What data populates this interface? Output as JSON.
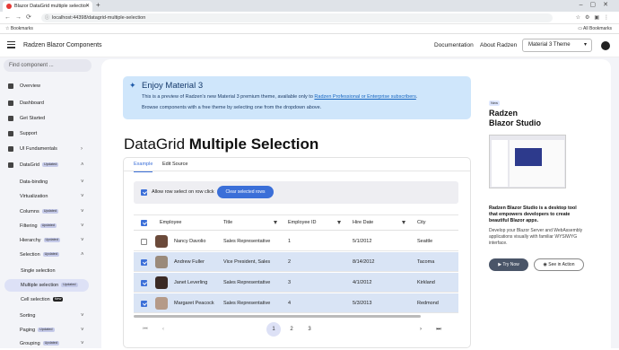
{
  "browser": {
    "tab_title": "Blazor DataGrid multiple selectio",
    "url": "localhost:44398/datagrid-multiple-selection",
    "bookmarks_label": "Bookmarks",
    "all_bookmarks_label": "All Bookmarks"
  },
  "header": {
    "brand": "Radzen Blazor Components",
    "documentation": "Documentation",
    "about": "About Radzen",
    "theme_selected": "Material 3 Theme"
  },
  "sidebar": {
    "search_placeholder": "Find component ...",
    "items": [
      {
        "label": "Overview"
      },
      {
        "label": "Dashboard"
      },
      {
        "label": "Get Started"
      },
      {
        "label": "Support"
      },
      {
        "label": "UI Fundamentals"
      },
      {
        "label": "DataGrid",
        "badge": "Updated"
      },
      {
        "label": "Data-binding"
      },
      {
        "label": "Virtualization"
      },
      {
        "label": "Columns",
        "badge": "Updated"
      },
      {
        "label": "Filtering",
        "badge": "Updated"
      },
      {
        "label": "Hierarchy",
        "badge": "Updated"
      },
      {
        "label": "Selection",
        "badge": "Updated"
      },
      {
        "label": "Single selection"
      },
      {
        "label": "Multiple selection",
        "badge": "Updated"
      },
      {
        "label": "Cell selection",
        "badge": "New"
      },
      {
        "label": "Sorting"
      },
      {
        "label": "Paging",
        "badge": "Updated"
      },
      {
        "label": "Grouping",
        "badge": "Updated"
      }
    ]
  },
  "banner": {
    "title": "Enjoy Material 3",
    "line1_prefix": "This is a preview of Radzen's new Material 3 premium theme, available only to ",
    "line1_link": "Radzen Professional or Enterprise subscribers",
    "line1_suffix": ".",
    "line2": "Browse components with a free theme by selecting one from the dropdown above."
  },
  "page": {
    "title_light": "DataGrid ",
    "title_bold": "Multiple Selection"
  },
  "tabs": [
    "Example",
    "Edit Source"
  ],
  "toolbar": {
    "checkbox_label": "Allow row select on row click",
    "checkbox_checked": true,
    "clear_button": "Clear selected rows"
  },
  "grid": {
    "columns": [
      "Employee",
      "Title",
      "Employee ID",
      "Hire Date",
      "City"
    ],
    "rows": [
      {
        "selected": false,
        "employee": "Nancy Davolio",
        "title": "Sales Representative",
        "id": "1",
        "hire": "5/1/2012",
        "city": "Seattle"
      },
      {
        "selected": true,
        "employee": "Andrew Fuller",
        "title": "Vice President, Sales",
        "id": "2",
        "hire": "8/14/2012",
        "city": "Tacoma"
      },
      {
        "selected": true,
        "employee": "Janet Leverling",
        "title": "Sales Representative",
        "id": "3",
        "hire": "4/1/2012",
        "city": "Kirkland"
      },
      {
        "selected": true,
        "employee": "Margaret Peacock",
        "title": "Sales Representative",
        "id": "4",
        "hire": "5/3/2013",
        "city": "Redmond"
      }
    ]
  },
  "pager": {
    "first": "⏮",
    "prev": "‹",
    "pages": [
      "1",
      "2",
      "3"
    ],
    "current": "1",
    "next": "›",
    "last": "⏭"
  },
  "promo": {
    "badge": "New",
    "title_line1": "Radzen",
    "title_line2": "Blazor Studio",
    "desc_bold": "Radzen Blazor Studio is a desktop tool that empowers developers to create beautiful Blazor apps.",
    "desc": "Develop your Blazor Server and WebAssembly applications visually with familiar WYSIWYG interface.",
    "try_button": "Try Now",
    "see_button": "See in Action"
  },
  "colors": {
    "accent": "#3b6fd8",
    "banner_bg": "#cfe6fb",
    "selected_row": "#d9e4f5"
  }
}
